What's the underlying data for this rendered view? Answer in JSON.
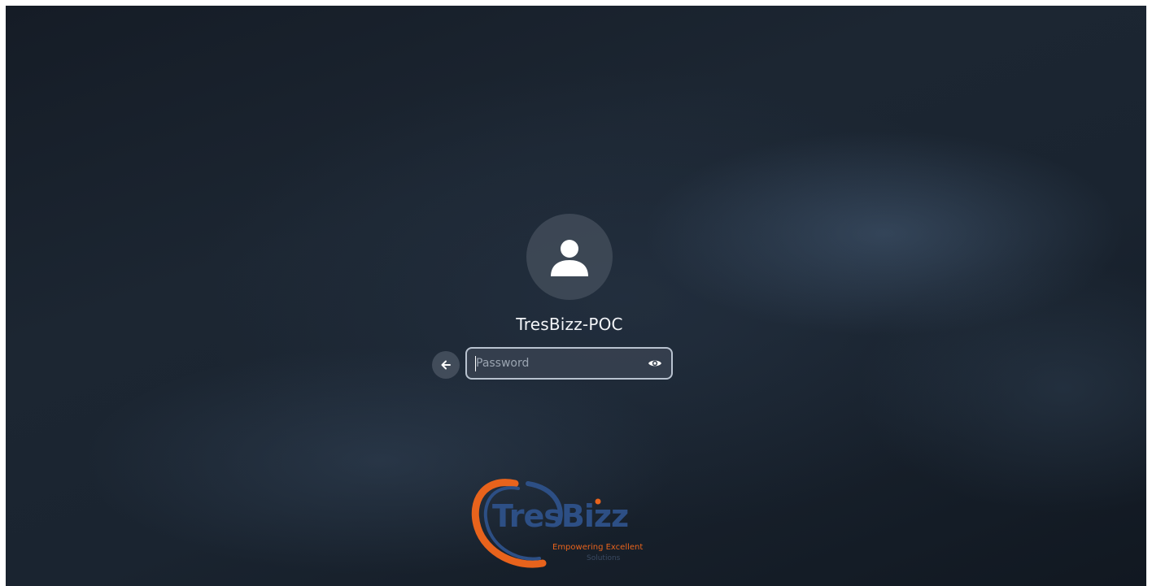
{
  "user": {
    "name": "TresBizz-POC",
    "avatar_icon": "user-icon"
  },
  "login": {
    "password_placeholder": "Password",
    "password_value": "",
    "back_icon": "arrow-left-icon",
    "reveal_icon": "eye-icon"
  },
  "branding": {
    "logo_text": "TresBizz",
    "tagline_line1": "Empowering Excellent",
    "tagline_line2": "Solutions",
    "colors": {
      "primary_blue": "#2d4f85",
      "accent_orange": "#e8631c"
    }
  },
  "theme": {
    "input_border": "#b8c2cf",
    "text": "#f2f4f7"
  }
}
